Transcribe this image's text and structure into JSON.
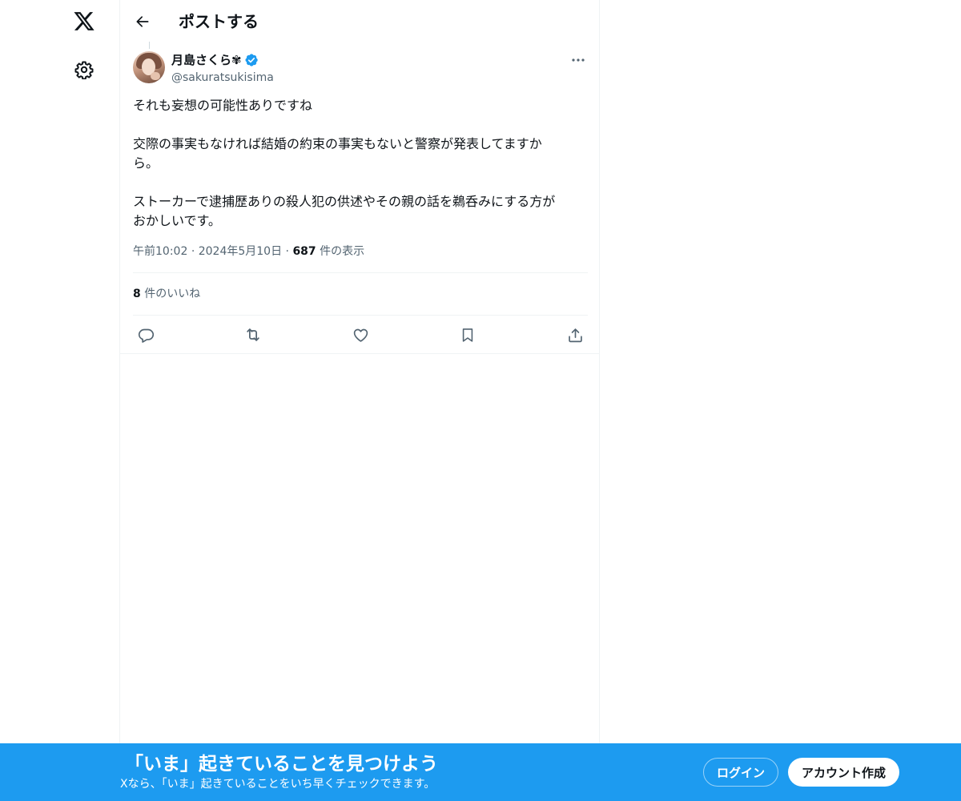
{
  "nav": {
    "logo_icon": "x-logo-icon",
    "settings_icon": "gear-icon"
  },
  "header": {
    "back_icon": "arrow-left-icon",
    "title": "ポストする"
  },
  "post": {
    "author": {
      "name": "月島さくら✾",
      "handle": "@sakuratsukisima",
      "verified": true,
      "verified_color": "#1d9bf0"
    },
    "more_icon": "more-horizontal-icon",
    "text": {
      "line1": "それも妄想の可能性ありですね",
      "line2": "交際の事実もなければ結婚の約束の事実もないと警察が発表してますか",
      "line3": "ら。",
      "line4": "ストーカーで逮捕歴ありの殺人犯の供述やその親の話を鵜呑みにする方が",
      "line5": "おかしいです。"
    },
    "meta": {
      "time": "午前10:02",
      "separator": "·",
      "date": "2024年5月10日",
      "views_count": "687",
      "views_label": "件の表示"
    },
    "likes": {
      "count": "8",
      "label": "件のいいね"
    },
    "actions": {
      "reply_icon": "reply-icon",
      "retweet_icon": "retweet-icon",
      "like_icon": "heart-icon",
      "bookmark_icon": "bookmark-icon",
      "share_icon": "share-icon"
    }
  },
  "bottom_bar": {
    "title": "「いま」起きていることを見つけよう",
    "subtitle": "Xなら、「いま」起きていることをいち早くチェックできます。",
    "login_label": "ログイン",
    "signup_label": "アカウント作成",
    "background_color": "#1d9bf0"
  }
}
